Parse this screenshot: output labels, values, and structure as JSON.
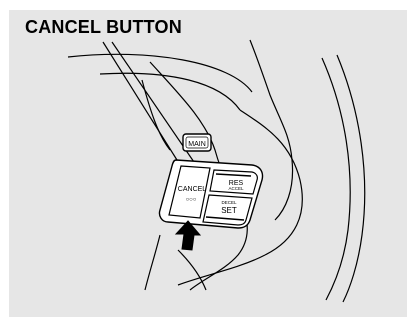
{
  "callout": {
    "label": "CANCEL BUTTON"
  },
  "buttons": {
    "main": "MAIN",
    "cancel": "CANCEL",
    "cancel_dots": "○○○",
    "res": "RES",
    "accel": "ACCEL",
    "decel": "DECEL",
    "set": "SET"
  },
  "icons": {
    "press_arrow": "arrow-up-icon"
  }
}
